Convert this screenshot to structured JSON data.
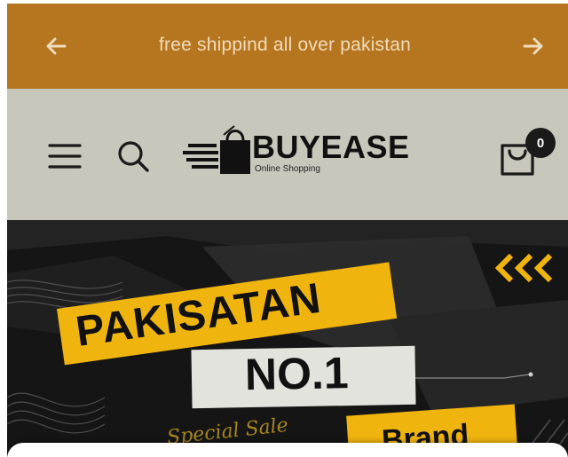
{
  "announcement": {
    "message": "free shippind all over pakistan",
    "prev_icon": "arrow-left-icon",
    "next_icon": "arrow-right-icon"
  },
  "header": {
    "logo_text": "BUYEASE",
    "logo_tagline": "Online Shopping",
    "menu_icon": "hamburger-menu-icon",
    "search_icon": "search-icon",
    "cart_icon": "shopping-bag-icon",
    "cart_count": "0"
  },
  "hero": {
    "line1": "PAKISATAN",
    "line2": "NO.1",
    "line3": "Brand",
    "script_text": "Special Sale",
    "decor_icon": "triple-chevron-left-icon"
  },
  "colors": {
    "announcement_bg": "#b5761f",
    "header_bg": "#c7c7bc",
    "accent_yellow": "#f0b40e",
    "hero_bg": "#141414"
  }
}
